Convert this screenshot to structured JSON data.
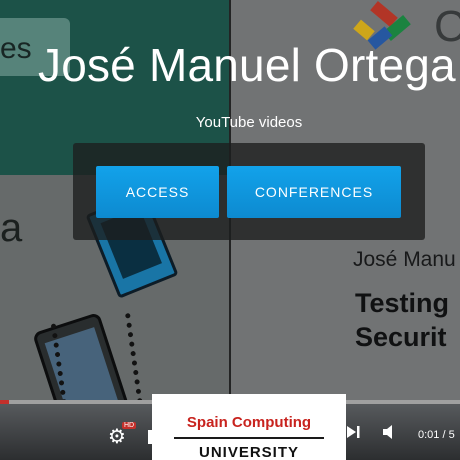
{
  "hero": {
    "title": "José Manuel Ortega",
    "subtitle": "YouTube videos"
  },
  "buttons": {
    "access": "ACCESS",
    "conferences": "CONFERENCES"
  },
  "background_slide": {
    "left_text_top": "es",
    "left_text_mid": "a",
    "right_letter": "C",
    "right_name": "José Manu",
    "right_line1": "Testing",
    "right_line2": "Securit"
  },
  "player": {
    "time": "0:01 / 5",
    "hd_label": "HD",
    "progress": 0.02
  },
  "badge": {
    "line1": "Spain Computing",
    "line2": "UNIVERSITY"
  },
  "colors": {
    "button_blue": "#0d8ad0",
    "youtube_red": "#c4302b",
    "badge_red": "#c8231e"
  },
  "icons": [
    "gear-icon",
    "next-icon",
    "volume-icon"
  ]
}
